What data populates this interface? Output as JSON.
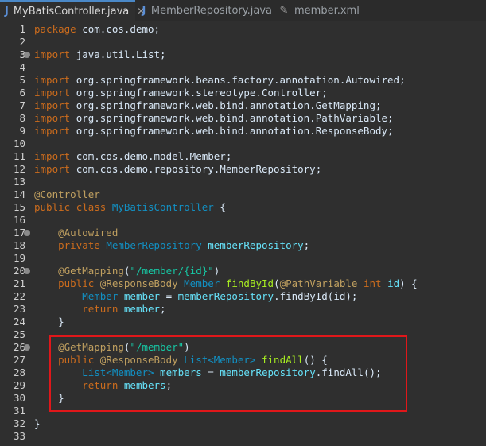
{
  "tabs": [
    {
      "label": "MyBatisController.java",
      "icon": "J",
      "active": true,
      "close": "✕"
    },
    {
      "label": "MemberRepository.java",
      "icon": "J",
      "active": false
    },
    {
      "label": "member.xml",
      "icon": "✎",
      "active": false
    }
  ],
  "lines": [
    {
      "n": "1",
      "fold": false,
      "tokens": [
        [
          "kw",
          "package"
        ],
        [
          "",
          "com.cos.demo;"
        ]
      ]
    },
    {
      "n": "2",
      "fold": false,
      "tokens": []
    },
    {
      "n": "3",
      "fold": true,
      "tokens": [
        [
          "kw",
          "import"
        ],
        [
          "",
          "java.util.List;"
        ]
      ]
    },
    {
      "n": "4",
      "fold": false,
      "tokens": []
    },
    {
      "n": "5",
      "fold": false,
      "tokens": [
        [
          "kw",
          "import"
        ],
        [
          "",
          "org.springframework.beans.factory.annotation.Autowired;"
        ]
      ]
    },
    {
      "n": "6",
      "fold": false,
      "tokens": [
        [
          "kw",
          "import"
        ],
        [
          "",
          "org.springframework.stereotype.Controller;"
        ]
      ]
    },
    {
      "n": "7",
      "fold": false,
      "tokens": [
        [
          "kw",
          "import"
        ],
        [
          "",
          "org.springframework.web.bind.annotation.GetMapping;"
        ]
      ]
    },
    {
      "n": "8",
      "fold": false,
      "tokens": [
        [
          "kw",
          "import"
        ],
        [
          "",
          "org.springframework.web.bind.annotation.PathVariable;"
        ]
      ]
    },
    {
      "n": "9",
      "fold": false,
      "tokens": [
        [
          "kw",
          "import"
        ],
        [
          "",
          "org.springframework.web.bind.annotation.ResponseBody;"
        ]
      ]
    },
    {
      "n": "10",
      "fold": false,
      "tokens": []
    },
    {
      "n": "11",
      "fold": false,
      "tokens": [
        [
          "kw",
          "import"
        ],
        [
          "",
          "com.cos.demo.model.Member;"
        ]
      ]
    },
    {
      "n": "12",
      "fold": false,
      "tokens": [
        [
          "kw",
          "import"
        ],
        [
          "",
          "com.cos.demo.repository.MemberRepository;"
        ]
      ]
    },
    {
      "n": "13",
      "fold": false,
      "tokens": []
    },
    {
      "n": "14",
      "fold": false,
      "tokens": [
        [
          "gold",
          "@Controller"
        ]
      ]
    },
    {
      "n": "15",
      "fold": false,
      "tokens": [
        [
          "kw",
          "public"
        ],
        [
          "kw",
          "class"
        ],
        [
          "type",
          "MyBatisController"
        ],
        [
          "",
          "{"
        ]
      ]
    },
    {
      "n": "16",
      "fold": false,
      "tokens": []
    },
    {
      "n": "17",
      "fold": true,
      "tokens": [
        [
          "gold",
          "    @Autowired"
        ]
      ]
    },
    {
      "n": "18",
      "fold": false,
      "tokens": [
        [
          "kw",
          "    private"
        ],
        [
          "type",
          "MemberRepository"
        ],
        [
          "field",
          "memberRepository"
        ],
        [
          "",
          ";"
        ]
      ]
    },
    {
      "n": "19",
      "fold": false,
      "tokens": []
    },
    {
      "n": "20",
      "fold": true,
      "tokens": [
        [
          "gold",
          "    @GetMapping"
        ],
        [
          "",
          "("
        ],
        [
          "str",
          "\"/member/{id}\""
        ],
        [
          "",
          ")"
        ]
      ]
    },
    {
      "n": "21",
      "fold": false,
      "tokens": [
        [
          "kw",
          "    public"
        ],
        [
          "gold",
          "@ResponseBody"
        ],
        [
          "type",
          "Member"
        ],
        [
          "method",
          "findById"
        ],
        [
          "",
          "("
        ],
        [
          "gold",
          "@PathVariable"
        ],
        [
          "kw",
          "int"
        ],
        [
          "field",
          "id"
        ],
        [
          "",
          ") {"
        ]
      ]
    },
    {
      "n": "22",
      "fold": false,
      "tokens": [
        [
          "type",
          "        Member"
        ],
        [
          "field",
          "member"
        ],
        [
          "",
          "="
        ],
        [
          "field",
          "memberRepository"
        ],
        [
          "",
          ".findById(id);"
        ]
      ]
    },
    {
      "n": "23",
      "fold": false,
      "tokens": [
        [
          "kw",
          "        return"
        ],
        [
          "field",
          "member"
        ],
        [
          "",
          ";"
        ]
      ]
    },
    {
      "n": "24",
      "fold": false,
      "tokens": [
        [
          "",
          "    }"
        ]
      ]
    },
    {
      "n": "25",
      "fold": false,
      "tokens": []
    },
    {
      "n": "26",
      "fold": true,
      "tokens": [
        [
          "gold",
          "    @GetMapping"
        ],
        [
          "",
          "("
        ],
        [
          "str",
          "\"/member\""
        ],
        [
          "",
          ")"
        ]
      ]
    },
    {
      "n": "27",
      "fold": false,
      "tokens": [
        [
          "kw",
          "    public"
        ],
        [
          "gold",
          "@ResponseBody"
        ],
        [
          "type",
          "List<Member>"
        ],
        [
          "method",
          "findAll"
        ],
        [
          "",
          "() {"
        ]
      ]
    },
    {
      "n": "28",
      "fold": false,
      "tokens": [
        [
          "type",
          "        List<Member>"
        ],
        [
          "field",
          "members"
        ],
        [
          "",
          "="
        ],
        [
          "field",
          "memberRepository"
        ],
        [
          "",
          ".findAll();"
        ]
      ]
    },
    {
      "n": "29",
      "fold": false,
      "tokens": [
        [
          "kw",
          "        return"
        ],
        [
          "field",
          "members"
        ],
        [
          "",
          ";"
        ]
      ]
    },
    {
      "n": "30",
      "fold": false,
      "tokens": [
        [
          "",
          "    }"
        ]
      ]
    },
    {
      "n": "31",
      "fold": false,
      "tokens": []
    },
    {
      "n": "32",
      "fold": false,
      "tokens": [
        [
          "",
          "}"
        ]
      ]
    },
    {
      "n": "33",
      "fold": false,
      "tokens": []
    }
  ]
}
